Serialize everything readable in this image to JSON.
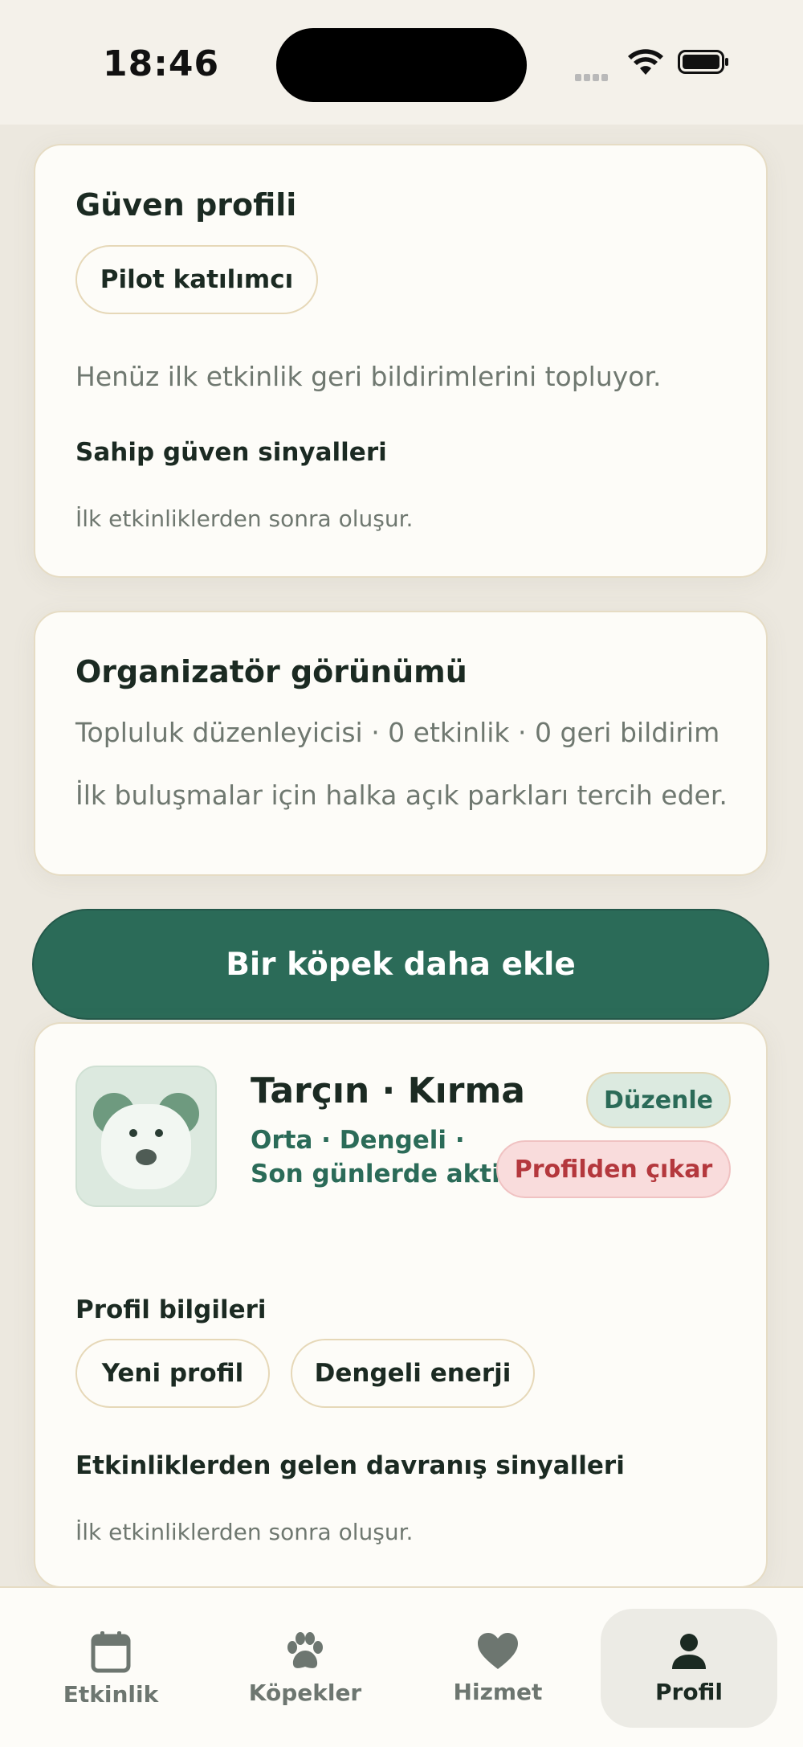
{
  "status_bar": {
    "time": "18:46"
  },
  "trust_card": {
    "title": "Güven profili",
    "badge": "Pilot katılımcı",
    "description": "Henüz ilk etkinlik geri bildirimlerini topluyor.",
    "owner_signals_title": "Sahip güven sinyalleri",
    "owner_signals_empty": "İlk etkinliklerden sonra oluşur."
  },
  "organizer_card": {
    "title": "Organizatör görünümü",
    "stats": "Topluluk düzenleyicisi · 0 etkinlik · 0 geri bildirim",
    "note": "İlk buluşmalar için halka açık parkları tercih eder."
  },
  "add_dog_button": "Bir köpek daha ekle",
  "dog_card": {
    "name": "Tarçın · Kırma",
    "meta_line1": "Orta · Dengeli ·",
    "meta_line2": "Son günlerde aktif",
    "edit_label": "Düzenle",
    "remove_label": "Profilden çıkar",
    "profile_info_title": "Profil bilgileri",
    "tags": [
      "Yeni profil",
      "Dengeli enerji"
    ],
    "behavior_title": "Etkinliklerden gelen davranış sinyalleri",
    "behavior_empty": "İlk etkinliklerden sonra oluşur."
  },
  "tab_bar": {
    "active": "Profil",
    "tabs": [
      {
        "label": "Etkinlik",
        "icon": "calendar-icon"
      },
      {
        "label": "Köpekler",
        "icon": "paw-icon"
      },
      {
        "label": "Hizmet",
        "icon": "heart-icon"
      },
      {
        "label": "Profil",
        "icon": "person-icon"
      }
    ]
  },
  "colors": {
    "primary": "#2b6b58",
    "danger": "#b4383d",
    "card_border": "#e6dcc4",
    "background": "#ece8df"
  }
}
